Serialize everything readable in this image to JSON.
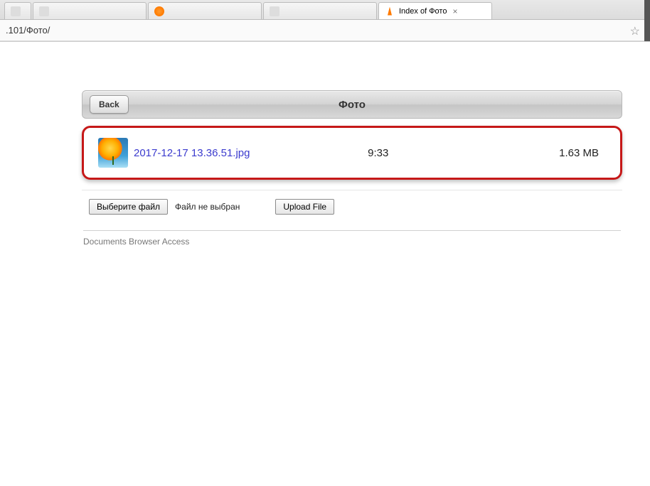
{
  "browser": {
    "tabs": [
      {
        "label": ""
      },
      {
        "label": ""
      },
      {
        "label": ""
      },
      {
        "label": ""
      },
      {
        "label": "Index of Фото"
      }
    ],
    "url": ".101/Фото/"
  },
  "header": {
    "back_label": "Back",
    "title": "Фото"
  },
  "file": {
    "name": "2017-12-17 13.36.51.jpg",
    "time": "9:33",
    "size": "1.63 MB"
  },
  "upload": {
    "choose_label": "Выберите файл",
    "no_file_label": "Файл не выбран",
    "upload_label": "Upload File"
  },
  "footer": {
    "text": "Documents Browser Access"
  }
}
